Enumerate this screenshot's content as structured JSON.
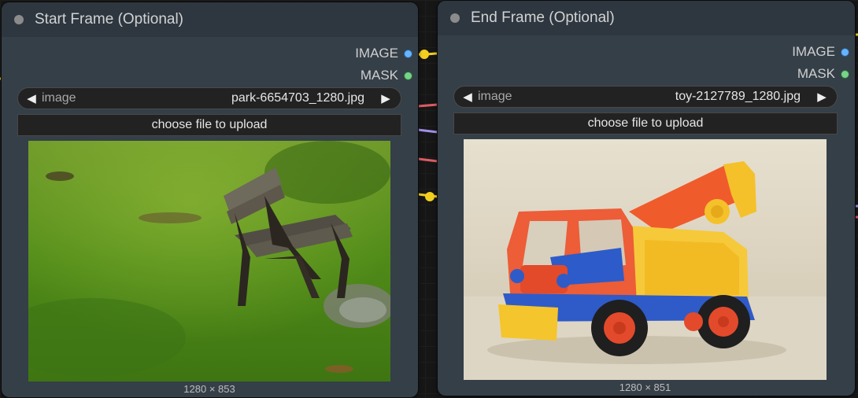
{
  "nodes": [
    {
      "title": "Start Frame (Optional)",
      "outputs": {
        "image": "IMAGE",
        "mask": "MASK"
      },
      "combo": {
        "name": "image",
        "value": "park-6654703_1280.jpg"
      },
      "upload_label": "choose file to upload",
      "preview_size": "1280 × 853"
    },
    {
      "title": "End Frame (Optional)",
      "outputs": {
        "image": "IMAGE",
        "mask": "MASK"
      },
      "combo": {
        "name": "image",
        "value": "toy-2127789_1280.jpg"
      },
      "upload_label": "choose file to upload",
      "preview_size": "1280 × 851"
    }
  ],
  "icons": {
    "combo_left": "◀",
    "combo_right": "▶"
  },
  "colors": {
    "image_socket": "#65b5ff",
    "mask_socket": "#76d48a",
    "wire_yellow": "#f2cf1f",
    "wire_red": "#e05c63",
    "wire_purple": "#a48fe8"
  }
}
